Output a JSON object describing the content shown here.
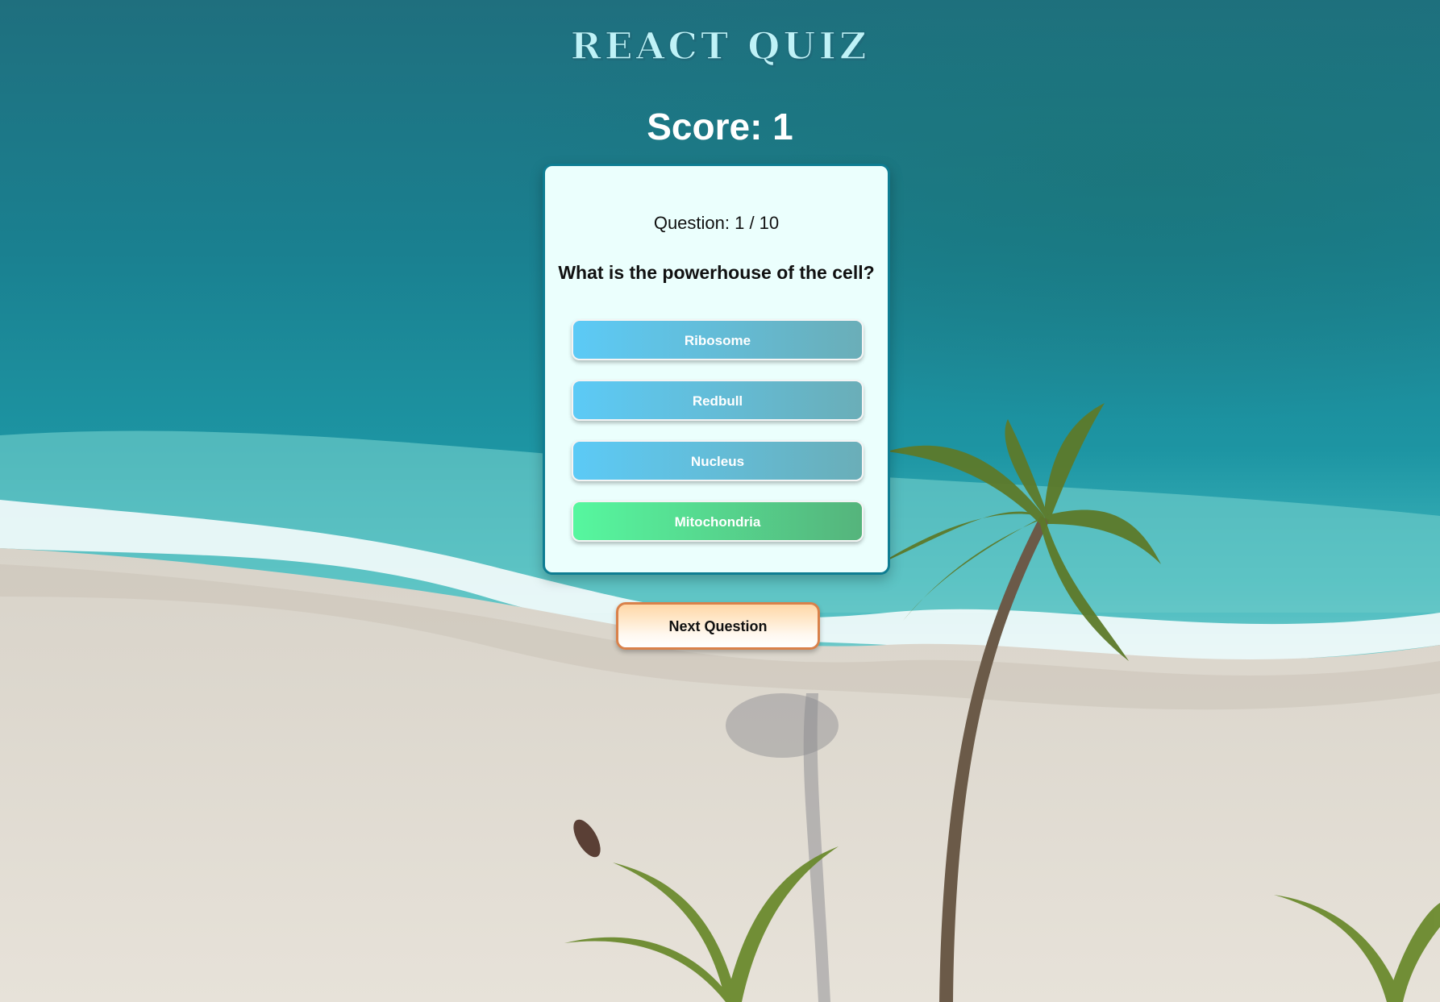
{
  "app": {
    "title": "REACT QUIZ"
  },
  "score": {
    "label": "Score: 1"
  },
  "question": {
    "counter": "Question: 1 / 10",
    "text": "What is the powerhouse of the cell?"
  },
  "answers": [
    {
      "label": "Ribosome",
      "state": "default"
    },
    {
      "label": "Redbull",
      "state": "default"
    },
    {
      "label": "Nucleus",
      "state": "default"
    },
    {
      "label": "Mitochondria",
      "state": "correct"
    }
  ],
  "next_button": {
    "label": "Next Question"
  },
  "colors": {
    "card_border": "#0e7d92",
    "answer_default": "#5ccaf6",
    "answer_correct": "#56f79f",
    "next_button_border": "#d9814a"
  }
}
